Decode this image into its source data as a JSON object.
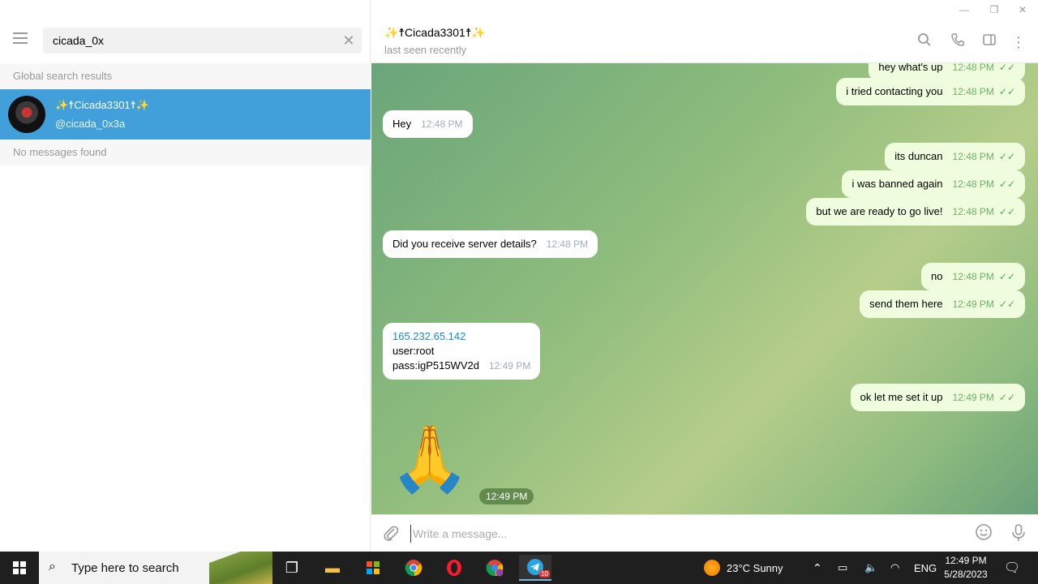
{
  "window": {
    "minimize": "—",
    "restore": "❐",
    "close": "✕"
  },
  "search": {
    "value": "cicada_0x",
    "clear": "✕"
  },
  "left": {
    "global_results_label": "Global search results",
    "result": {
      "name": "✨☨Cicada3301☨✨",
      "username": "@cicada_0x3a"
    },
    "no_messages_label": "No messages found"
  },
  "chat": {
    "title": "✨☨Cicada3301☨✨",
    "status": "last seen recently",
    "messages": [
      {
        "dir": "out",
        "text": "hey what's up",
        "time": "12:48 PM"
      },
      {
        "dir": "out",
        "text": "i tried contacting you",
        "time": "12:48 PM"
      },
      {
        "dir": "in",
        "text": "Hey",
        "time": "12:48 PM"
      },
      {
        "dir": "out",
        "text": "its duncan",
        "time": "12:48 PM"
      },
      {
        "dir": "out",
        "text": "i was banned again",
        "time": "12:48 PM"
      },
      {
        "dir": "out",
        "text": "but we are ready to go live!",
        "time": "12:48 PM"
      },
      {
        "dir": "in",
        "text": "Did you receive server details?",
        "time": "12:48 PM"
      },
      {
        "dir": "out",
        "text": "no",
        "time": "12:48 PM"
      },
      {
        "dir": "out",
        "text": "send them here",
        "time": "12:49 PM"
      },
      {
        "dir": "in",
        "link": "165.232.65.142",
        "line2": "user:root",
        "line3": "pass:igP515WV2d",
        "time": "12:49 PM"
      },
      {
        "dir": "out",
        "text": "ok let me set it up",
        "time": "12:49 PM"
      },
      {
        "dir": "in",
        "emoji": "🙏",
        "time": "12:49 PM"
      }
    ],
    "composer_placeholder": "Write a message..."
  },
  "taskbar": {
    "search_placeholder": "Type here to search",
    "weather": "23°C  Sunny",
    "lang": "ENG",
    "time": "12:49 PM",
    "date": "5/28/2023",
    "telegram_badge": "10"
  }
}
